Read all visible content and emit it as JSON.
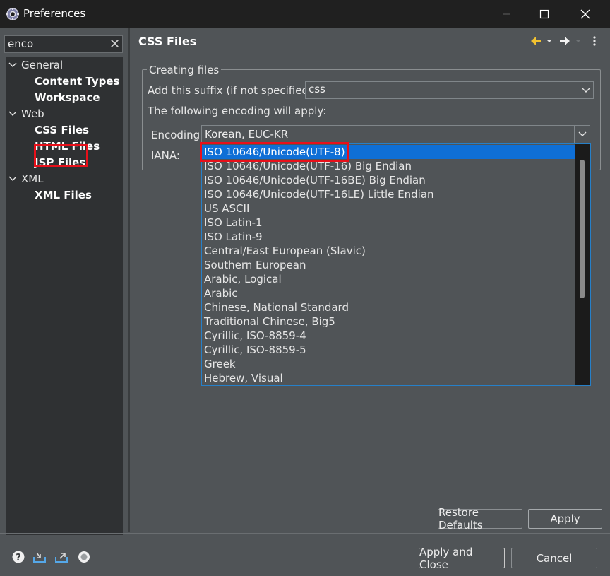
{
  "window": {
    "title": "Preferences",
    "icon": "gear-icon"
  },
  "filter": {
    "value": "enco",
    "clear_icon": "clear-icon"
  },
  "tree": [
    {
      "label": "General",
      "level": 0,
      "expanded": true
    },
    {
      "label": "Content Types",
      "level": 1
    },
    {
      "label": "Workspace",
      "level": 1
    },
    {
      "label": "Web",
      "level": 0,
      "expanded": true
    },
    {
      "label": "CSS Files",
      "level": 1,
      "selected": true
    },
    {
      "label": "HTML Files",
      "level": 1
    },
    {
      "label": "JSP Files",
      "level": 1
    },
    {
      "label": "XML",
      "level": 0,
      "expanded": true
    },
    {
      "label": "XML Files",
      "level": 1
    }
  ],
  "page": {
    "title": "CSS Files",
    "group_label": "Creating files",
    "suffix_label": "Add this suffix (if not specified):",
    "suffix_value": "css",
    "encoding_note": "The following encoding will apply:",
    "encoding_label": "Encoding:",
    "encoding_value": "Korean, EUC-KR",
    "iana_label": "IANA:"
  },
  "encoding_options": [
    "ISO 10646/Unicode(UTF-8)",
    "ISO 10646/Unicode(UTF-16) Big Endian",
    "ISO 10646/Unicode(UTF-16BE) Big Endian",
    "ISO 10646/Unicode(UTF-16LE) Little Endian",
    "US ASCII",
    "ISO Latin-1",
    "ISO Latin-9",
    "Central/East European (Slavic)",
    "Southern European",
    "Arabic, Logical",
    "Arabic",
    "Chinese, National Standard",
    "Traditional Chinese, Big5",
    "Cyrillic, ISO-8859-4",
    "Cyrillic, ISO-8859-5",
    "Greek",
    "Hebrew, Visual"
  ],
  "highlighted_option": "ISO 10646/Unicode(UTF-8)",
  "buttons": {
    "restore_defaults": "Restore Defaults",
    "apply": "Apply",
    "apply_and_close": "Apply and Close",
    "cancel": "Cancel"
  },
  "colors": {
    "highlight": "#0f6fd6",
    "annotation": "#e8101a"
  }
}
